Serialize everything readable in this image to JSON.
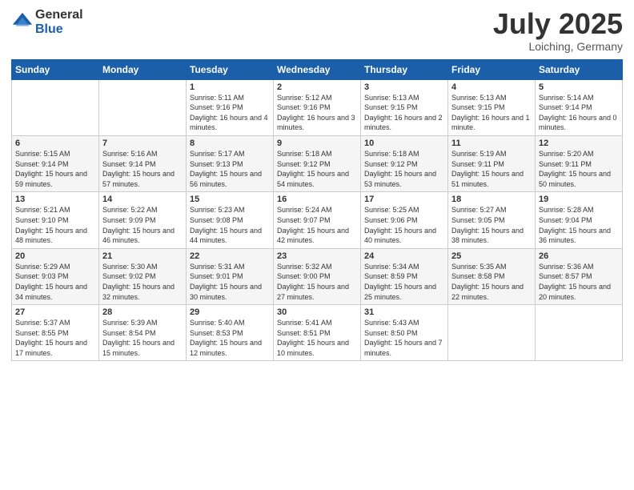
{
  "logo": {
    "general": "General",
    "blue": "Blue"
  },
  "header": {
    "month": "July 2025",
    "location": "Loiching, Germany"
  },
  "weekdays": [
    "Sunday",
    "Monday",
    "Tuesday",
    "Wednesday",
    "Thursday",
    "Friday",
    "Saturday"
  ],
  "weeks": [
    [
      {
        "day": "",
        "sunrise": "",
        "sunset": "",
        "daylight": ""
      },
      {
        "day": "",
        "sunrise": "",
        "sunset": "",
        "daylight": ""
      },
      {
        "day": "1",
        "sunrise": "Sunrise: 5:11 AM",
        "sunset": "Sunset: 9:16 PM",
        "daylight": "Daylight: 16 hours and 4 minutes."
      },
      {
        "day": "2",
        "sunrise": "Sunrise: 5:12 AM",
        "sunset": "Sunset: 9:16 PM",
        "daylight": "Daylight: 16 hours and 3 minutes."
      },
      {
        "day": "3",
        "sunrise": "Sunrise: 5:13 AM",
        "sunset": "Sunset: 9:15 PM",
        "daylight": "Daylight: 16 hours and 2 minutes."
      },
      {
        "day": "4",
        "sunrise": "Sunrise: 5:13 AM",
        "sunset": "Sunset: 9:15 PM",
        "daylight": "Daylight: 16 hours and 1 minute."
      },
      {
        "day": "5",
        "sunrise": "Sunrise: 5:14 AM",
        "sunset": "Sunset: 9:14 PM",
        "daylight": "Daylight: 16 hours and 0 minutes."
      }
    ],
    [
      {
        "day": "6",
        "sunrise": "Sunrise: 5:15 AM",
        "sunset": "Sunset: 9:14 PM",
        "daylight": "Daylight: 15 hours and 59 minutes."
      },
      {
        "day": "7",
        "sunrise": "Sunrise: 5:16 AM",
        "sunset": "Sunset: 9:14 PM",
        "daylight": "Daylight: 15 hours and 57 minutes."
      },
      {
        "day": "8",
        "sunrise": "Sunrise: 5:17 AM",
        "sunset": "Sunset: 9:13 PM",
        "daylight": "Daylight: 15 hours and 56 minutes."
      },
      {
        "day": "9",
        "sunrise": "Sunrise: 5:18 AM",
        "sunset": "Sunset: 9:12 PM",
        "daylight": "Daylight: 15 hours and 54 minutes."
      },
      {
        "day": "10",
        "sunrise": "Sunrise: 5:18 AM",
        "sunset": "Sunset: 9:12 PM",
        "daylight": "Daylight: 15 hours and 53 minutes."
      },
      {
        "day": "11",
        "sunrise": "Sunrise: 5:19 AM",
        "sunset": "Sunset: 9:11 PM",
        "daylight": "Daylight: 15 hours and 51 minutes."
      },
      {
        "day": "12",
        "sunrise": "Sunrise: 5:20 AM",
        "sunset": "Sunset: 9:11 PM",
        "daylight": "Daylight: 15 hours and 50 minutes."
      }
    ],
    [
      {
        "day": "13",
        "sunrise": "Sunrise: 5:21 AM",
        "sunset": "Sunset: 9:10 PM",
        "daylight": "Daylight: 15 hours and 48 minutes."
      },
      {
        "day": "14",
        "sunrise": "Sunrise: 5:22 AM",
        "sunset": "Sunset: 9:09 PM",
        "daylight": "Daylight: 15 hours and 46 minutes."
      },
      {
        "day": "15",
        "sunrise": "Sunrise: 5:23 AM",
        "sunset": "Sunset: 9:08 PM",
        "daylight": "Daylight: 15 hours and 44 minutes."
      },
      {
        "day": "16",
        "sunrise": "Sunrise: 5:24 AM",
        "sunset": "Sunset: 9:07 PM",
        "daylight": "Daylight: 15 hours and 42 minutes."
      },
      {
        "day": "17",
        "sunrise": "Sunrise: 5:25 AM",
        "sunset": "Sunset: 9:06 PM",
        "daylight": "Daylight: 15 hours and 40 minutes."
      },
      {
        "day": "18",
        "sunrise": "Sunrise: 5:27 AM",
        "sunset": "Sunset: 9:05 PM",
        "daylight": "Daylight: 15 hours and 38 minutes."
      },
      {
        "day": "19",
        "sunrise": "Sunrise: 5:28 AM",
        "sunset": "Sunset: 9:04 PM",
        "daylight": "Daylight: 15 hours and 36 minutes."
      }
    ],
    [
      {
        "day": "20",
        "sunrise": "Sunrise: 5:29 AM",
        "sunset": "Sunset: 9:03 PM",
        "daylight": "Daylight: 15 hours and 34 minutes."
      },
      {
        "day": "21",
        "sunrise": "Sunrise: 5:30 AM",
        "sunset": "Sunset: 9:02 PM",
        "daylight": "Daylight: 15 hours and 32 minutes."
      },
      {
        "day": "22",
        "sunrise": "Sunrise: 5:31 AM",
        "sunset": "Sunset: 9:01 PM",
        "daylight": "Daylight: 15 hours and 30 minutes."
      },
      {
        "day": "23",
        "sunrise": "Sunrise: 5:32 AM",
        "sunset": "Sunset: 9:00 PM",
        "daylight": "Daylight: 15 hours and 27 minutes."
      },
      {
        "day": "24",
        "sunrise": "Sunrise: 5:34 AM",
        "sunset": "Sunset: 8:59 PM",
        "daylight": "Daylight: 15 hours and 25 minutes."
      },
      {
        "day": "25",
        "sunrise": "Sunrise: 5:35 AM",
        "sunset": "Sunset: 8:58 PM",
        "daylight": "Daylight: 15 hours and 22 minutes."
      },
      {
        "day": "26",
        "sunrise": "Sunrise: 5:36 AM",
        "sunset": "Sunset: 8:57 PM",
        "daylight": "Daylight: 15 hours and 20 minutes."
      }
    ],
    [
      {
        "day": "27",
        "sunrise": "Sunrise: 5:37 AM",
        "sunset": "Sunset: 8:55 PM",
        "daylight": "Daylight: 15 hours and 17 minutes."
      },
      {
        "day": "28",
        "sunrise": "Sunrise: 5:39 AM",
        "sunset": "Sunset: 8:54 PM",
        "daylight": "Daylight: 15 hours and 15 minutes."
      },
      {
        "day": "29",
        "sunrise": "Sunrise: 5:40 AM",
        "sunset": "Sunset: 8:53 PM",
        "daylight": "Daylight: 15 hours and 12 minutes."
      },
      {
        "day": "30",
        "sunrise": "Sunrise: 5:41 AM",
        "sunset": "Sunset: 8:51 PM",
        "daylight": "Daylight: 15 hours and 10 minutes."
      },
      {
        "day": "31",
        "sunrise": "Sunrise: 5:43 AM",
        "sunset": "Sunset: 8:50 PM",
        "daylight": "Daylight: 15 hours and 7 minutes."
      },
      {
        "day": "",
        "sunrise": "",
        "sunset": "",
        "daylight": ""
      },
      {
        "day": "",
        "sunrise": "",
        "sunset": "",
        "daylight": ""
      }
    ]
  ]
}
